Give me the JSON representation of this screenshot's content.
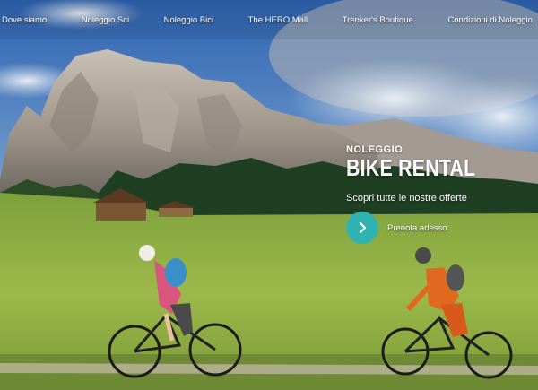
{
  "nav": {
    "items": [
      {
        "label": "Dove siamo"
      },
      {
        "label": "Noleggio Sci"
      },
      {
        "label": "Noleggio Bici"
      },
      {
        "label": "The HERO Mall"
      },
      {
        "label": "Trenker's Boutique"
      },
      {
        "label": "Condizioni di Noleggio"
      }
    ]
  },
  "hero": {
    "kicker": "NOLEGGIO",
    "headline": "BIKE RENTAL",
    "subline": "Scopri tutte le nostre offerte",
    "cta_label": "Prenota adesso",
    "cta_icon": "chevron-right-icon"
  },
  "colors": {
    "accent": "#2fb3b0"
  }
}
